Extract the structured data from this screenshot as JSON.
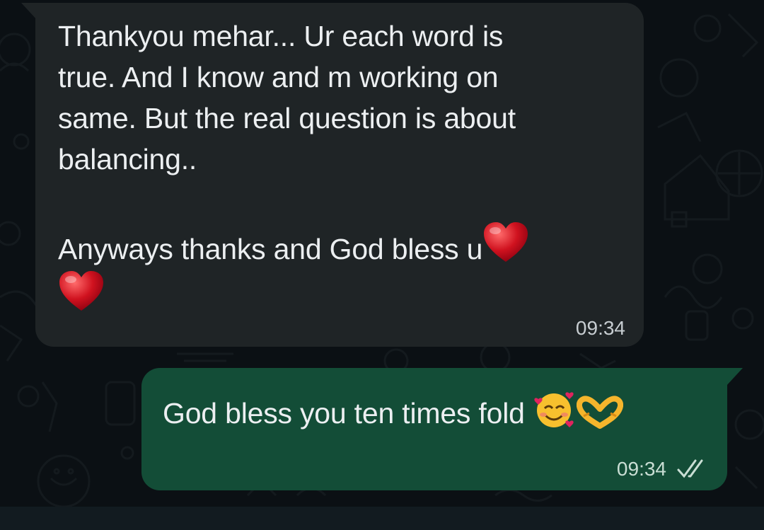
{
  "incoming_message": {
    "line1": "Thankyou mehar... Ur each word is",
    "line2": "true. And I know and m working on",
    "line3": "same. But the real question is about",
    "line4": "balancing..",
    "line5": "Anyways thanks and God bless u",
    "time": "09:34"
  },
  "outgoing_message": {
    "text": "God bless you ten times fold",
    "time": "09:34",
    "status": "read"
  },
  "colors": {
    "incoming_bubble": "#1f2426",
    "outgoing_bubble": "#134d37",
    "background": "#0b1014",
    "heart": "#d0121f"
  },
  "icons": [
    "red-heart-icon",
    "smiling-face-with-hearts-icon",
    "heart-hands-icon",
    "double-check-icon"
  ]
}
